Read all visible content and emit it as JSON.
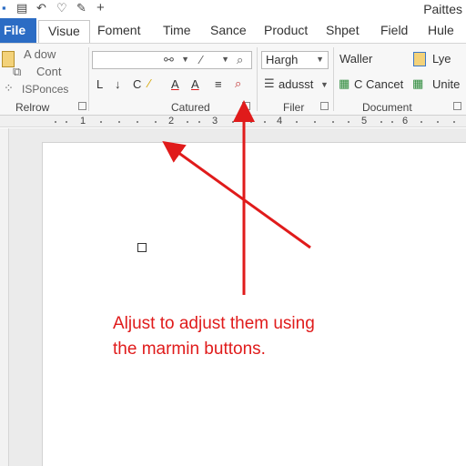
{
  "quick_access": {
    "title": "Paittes",
    "icons": [
      "save-icon",
      "list-icon",
      "heart-icon",
      "pen-icon",
      "add-icon"
    ]
  },
  "tabs": [
    {
      "label": "File"
    },
    {
      "label": "Visue"
    },
    {
      "label": "Foment"
    },
    {
      "label": "Time"
    },
    {
      "label": "Sance"
    },
    {
      "label": "Product"
    },
    {
      "label": "Shpet"
    },
    {
      "label": "Field"
    },
    {
      "label": "Hule"
    }
  ],
  "ribbon": {
    "clipboard": {
      "items": [
        "A dow",
        "Cont",
        "ISPonces"
      ],
      "label": "Relrow"
    },
    "font": {
      "tools_row2": [
        "L",
        "↓",
        "C",
        "A",
        "A",
        "≡"
      ],
      "label": "Catured"
    },
    "styles": {
      "combo_value": "Hargh",
      "adjust_label": "adusst",
      "label": "Filer"
    },
    "document": {
      "items": [
        "Waller",
        "C Cancet",
        "Lye",
        "Unite"
      ],
      "label": "Document"
    }
  },
  "ruler": {
    "numbers": [
      "1",
      "2",
      "3",
      "4",
      "5",
      "6"
    ]
  },
  "annotation": {
    "line1": "Aljust to adjust them using",
    "line2": "the marmin buttons.",
    "color": "#e01b1b"
  },
  "colors": {
    "file_tab": "#2b6cc4",
    "arrow": "#e01b1b"
  }
}
